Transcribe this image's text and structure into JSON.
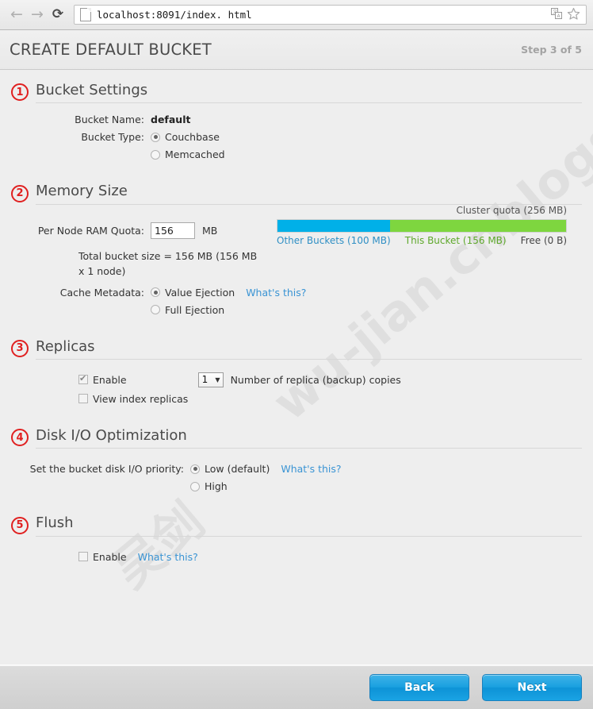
{
  "browser": {
    "back_icon": "arrow-left-icon",
    "forward_icon": "arrow-right-icon",
    "reload_icon": "reload-icon",
    "page_icon": "page-icon",
    "url": "localhost:8091/index. html",
    "translate_icon": "translate-icon",
    "bookmark_icon": "star-icon"
  },
  "header": {
    "title": "CREATE DEFAULT BUCKET",
    "step": "Step 3 of 5"
  },
  "watermark": {
    "line1": "wu-jian.cnblogs.com",
    "line2": "吴剑"
  },
  "sections": {
    "bucket_settings": {
      "number": "1",
      "title": "Bucket Settings",
      "name_label": "Bucket Name:",
      "name_value": "default",
      "type_label": "Bucket Type:",
      "type_options": [
        {
          "label": "Couchbase",
          "checked": true
        },
        {
          "label": "Memcached",
          "checked": false
        }
      ]
    },
    "memory_size": {
      "number": "2",
      "title": "Memory Size",
      "quota_label": "Per Node RAM Quota:",
      "quota_value": "156",
      "quota_unit": "MB",
      "cluster_quota": "Cluster quota (256 MB)",
      "legend_other": "Other Buckets (100 MB)",
      "legend_this": "This Bucket (156 MB)",
      "legend_free": "Free (0 B)",
      "total_size": "Total bucket size = 156 MB (156 MB x 1 node)",
      "cache_label": "Cache Metadata:",
      "cache_options": [
        {
          "label": "Value Ejection",
          "checked": true
        },
        {
          "label": "Full Ejection",
          "checked": false
        }
      ],
      "whats_this": "What's this?"
    },
    "replicas": {
      "number": "3",
      "title": "Replicas",
      "enable_label": "Enable",
      "enable_checked": true,
      "replica_count": "1",
      "caret": "▼",
      "count_label": "Number of replica (backup) copies",
      "view_index_label": "View index replicas",
      "view_index_checked": false
    },
    "disk_io": {
      "number": "4",
      "title": "Disk I/O Optimization",
      "priority_label": "Set the bucket disk I/O priority:",
      "priority_options": [
        {
          "label": "Low (default)",
          "checked": true
        },
        {
          "label": "High",
          "checked": false
        }
      ],
      "whats_this": "What's this?"
    },
    "flush": {
      "number": "5",
      "title": "Flush",
      "enable_label": "Enable",
      "enable_checked": false,
      "whats_this": "What's this?"
    }
  },
  "footer": {
    "back_label": "Back",
    "next_label": "Next"
  },
  "chart_data": {
    "type": "bar",
    "title": "Cluster quota (256 MB)",
    "categories": [
      "Other Buckets",
      "This Bucket",
      "Free"
    ],
    "values": [
      100,
      156,
      0
    ],
    "unit": "MB",
    "total": 256,
    "colors": [
      "#00b0e8",
      "#7ed63f",
      "#ffffff"
    ],
    "legend_position": "bottom"
  }
}
